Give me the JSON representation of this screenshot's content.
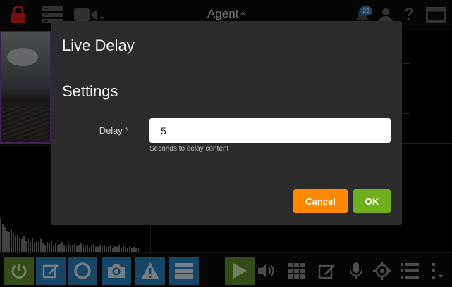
{
  "topbar": {
    "title": "Agent",
    "caret": "^",
    "notification_count": "22",
    "help_glyph": "?"
  },
  "toolbar": {
    "buttons": [
      {
        "name": "power",
        "color": "#5d8a2a"
      },
      {
        "name": "edit",
        "color": "#2a7fb8"
      },
      {
        "name": "record",
        "color": "#2a7fb8"
      },
      {
        "name": "snapshot",
        "color": "#2a7fb8"
      },
      {
        "name": "alert",
        "color": "#2a7fb8"
      },
      {
        "name": "list",
        "color": "#2a7fb8"
      },
      {
        "name": "play",
        "color": "#5d8a2a"
      }
    ]
  },
  "modal": {
    "title": "Live Delay",
    "section_title": "Settings",
    "field": {
      "label": "Delay",
      "required_marker": "*",
      "value": "5",
      "hint": "Seconds to delay content"
    },
    "cancel_label": "Cancel",
    "ok_label": "OK"
  },
  "colors": {
    "accent_orange": "#ff8a00",
    "accent_green": "#6fae1c",
    "toolbar_blue": "#2a7fb8",
    "lock_red": "#d81b1b"
  }
}
